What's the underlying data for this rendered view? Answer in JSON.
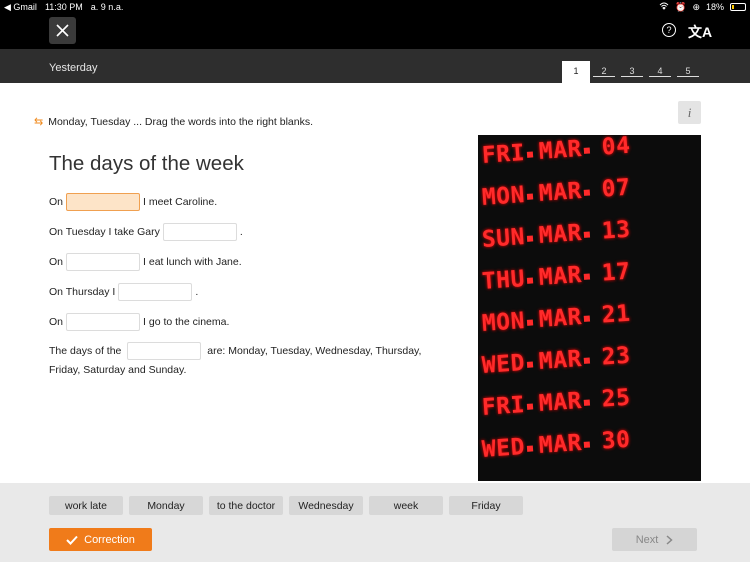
{
  "status_bar": {
    "back_app": "◀ Gmail",
    "time": "11:30 PM",
    "date": "a. 9 n.a.",
    "battery": "18%",
    "battery_level": 0.18
  },
  "top_bar": {
    "close_icon": "close-icon",
    "help_icon": "help-icon",
    "translate_icon": "translate-icon"
  },
  "lesson": {
    "title": "Yesterday",
    "pages": [
      "1",
      "2",
      "3",
      "4",
      "5"
    ],
    "active_page": "1"
  },
  "info_label": "i",
  "instruction": "Monday, Tuesday ... Drag the words into the right blanks.",
  "exercise": {
    "title": "The days of the week",
    "lines": [
      {
        "before": "On",
        "after": "I meet Caroline."
      },
      {
        "before": "On Tuesday I take Gary",
        "after": "."
      },
      {
        "before": "On",
        "after": "I eat lunch with Jane."
      },
      {
        "before": "On Thursday I",
        "after": "."
      },
      {
        "before": "On",
        "after": "I go to the cinema."
      },
      {
        "before": "The days of the",
        "after": "are: Monday, Tuesday, Wednesday, Thursday, Friday, Saturday and Sunday."
      }
    ]
  },
  "led_board": [
    {
      "day": "FRI",
      "month": "MAR",
      "date": "04"
    },
    {
      "day": "MON",
      "month": "MAR",
      "date": "07"
    },
    {
      "day": "SUN",
      "month": "MAR",
      "date": "13"
    },
    {
      "day": "THU",
      "month": "MAR",
      "date": "17"
    },
    {
      "day": "MON",
      "month": "MAR",
      "date": "21"
    },
    {
      "day": "WED",
      "month": "MAR",
      "date": "23"
    },
    {
      "day": "FRI",
      "month": "MAR",
      "date": "25"
    },
    {
      "day": "WED",
      "month": "MAR",
      "date": "30"
    }
  ],
  "word_bank": [
    "work late",
    "Monday",
    "to the doctor",
    "Wednesday",
    "week",
    "Friday"
  ],
  "buttons": {
    "correction": "Correction",
    "next": "Next"
  },
  "colors": {
    "accent": "#f07b1a",
    "led_red": "#ff2a2a",
    "active_blank": "#fde4c8"
  }
}
